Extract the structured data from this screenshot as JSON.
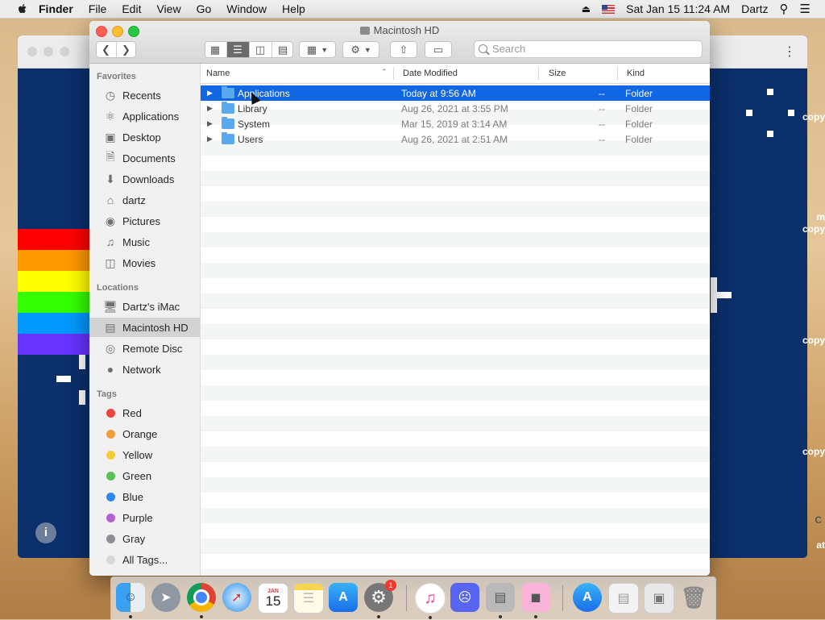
{
  "menubar": {
    "app": "Finder",
    "items": [
      "File",
      "Edit",
      "View",
      "Go",
      "Window",
      "Help"
    ],
    "datetime": "Sat Jan 15  11:24 AM",
    "user": "Dartz"
  },
  "window": {
    "title": "Macintosh HD",
    "search_placeholder": "Search"
  },
  "sidebar": {
    "favorites_header": "Favorites",
    "favorites": [
      "Recents",
      "Applications",
      "Desktop",
      "Documents",
      "Downloads",
      "dartz",
      "Pictures",
      "Music",
      "Movies"
    ],
    "locations_header": "Locations",
    "locations": [
      "Dartz's iMac",
      "Macintosh HD",
      "Remote Disc",
      "Network"
    ],
    "selected_location": "Macintosh HD",
    "tags_header": "Tags",
    "tags": [
      {
        "label": "Red",
        "color": "#ee4540"
      },
      {
        "label": "Orange",
        "color": "#f39d38"
      },
      {
        "label": "Yellow",
        "color": "#f5cb3b"
      },
      {
        "label": "Green",
        "color": "#5ac05a"
      },
      {
        "label": "Blue",
        "color": "#2f86ee"
      },
      {
        "label": "Purple",
        "color": "#b460d1"
      },
      {
        "label": "Gray",
        "color": "#8e8e93"
      },
      {
        "label": "All Tags...",
        "color": "#d8d8d8"
      }
    ]
  },
  "columns": {
    "name": "Name",
    "date": "Date Modified",
    "size": "Size",
    "kind": "Kind"
  },
  "files": [
    {
      "name": "Applications",
      "date": "Today at 9:56 AM",
      "size": "--",
      "kind": "Folder",
      "selected": true
    },
    {
      "name": "Library",
      "date": "Aug 26, 2021 at 3:55 PM",
      "size": "--",
      "kind": "Folder"
    },
    {
      "name": "System",
      "date": "Mar 15, 2019 at 3:14 AM",
      "size": "--",
      "kind": "Folder"
    },
    {
      "name": "Users",
      "date": "Aug 26, 2021 at 2:51 AM",
      "size": "--",
      "kind": "Folder"
    }
  ],
  "background": {
    "side_labels": [
      "copy",
      "m",
      "copy",
      "copy",
      "copy",
      "C",
      "at"
    ]
  },
  "dock": {
    "calendar_month": "JAN",
    "calendar_day": "15",
    "system_prefs_badge": "1"
  }
}
